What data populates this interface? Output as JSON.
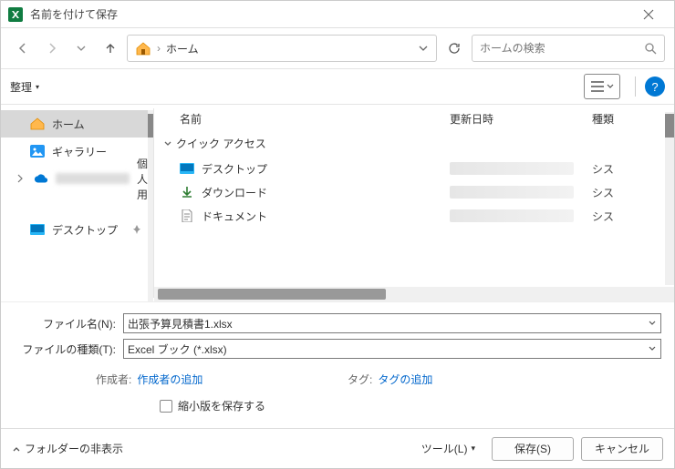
{
  "title": "名前を付けて保存",
  "breadcrumb": "ホーム",
  "search_placeholder": "ホームの検索",
  "toolbar": {
    "organize": "整理"
  },
  "sidebar": {
    "home": "ホーム",
    "gallery": "ギャラリー",
    "personal": "個人用",
    "desktop": "デスクトップ"
  },
  "columns": {
    "name": "名前",
    "date": "更新日時",
    "type": "種類"
  },
  "group": "クイック アクセス",
  "rows": {
    "desktop": "デスクトップ",
    "downloads": "ダウンロード",
    "documents": "ドキュメント",
    "type_sys": "シス"
  },
  "form": {
    "filename_label": "ファイル名(N):",
    "filename_value": "出張予算見積書1.xlsx",
    "filetype_label": "ファイルの種類(T):",
    "filetype_value": "Excel ブック (*.xlsx)",
    "author_label": "作成者:",
    "author_value": "作成者の追加",
    "tag_label": "タグ:",
    "tag_value": "タグの追加",
    "thumbnail": "縮小版を保存する"
  },
  "footer": {
    "hide_folders": "フォルダーの非表示",
    "tools": "ツール(L)",
    "save": "保存(S)",
    "cancel": "キャンセル"
  }
}
